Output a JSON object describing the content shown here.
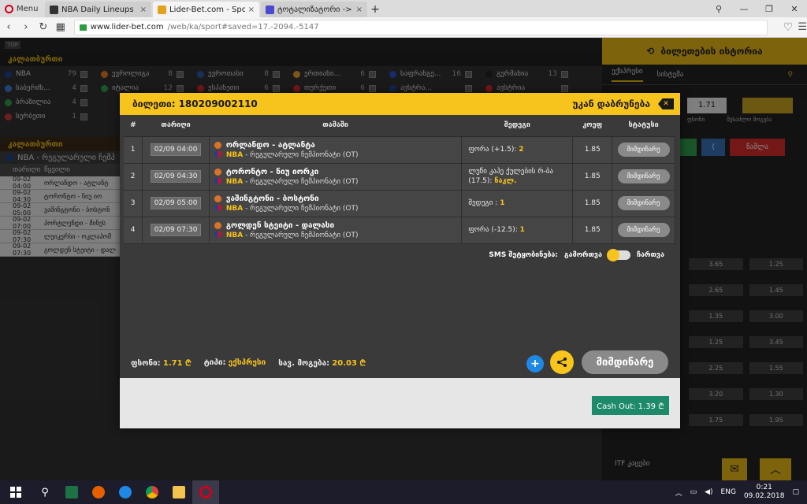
{
  "browser": {
    "menu_label": "Menu",
    "tabs": [
      {
        "title": "NBA Daily Lineups | RotoW",
        "close": "×",
        "favicon_color": "#333333"
      },
      {
        "title": "Lider-Bet.com - Sports an",
        "close": "×",
        "favicon_color": "#e4a11b"
      },
      {
        "title": "ტოტალიზატორი -> oი",
        "close": "×",
        "favicon_color": "#4a4ad0"
      }
    ],
    "new_tab": "+",
    "url_host": "www.lider-bet.com",
    "url_path": "/web/ka/sport#saved=17.-2094.-5147"
  },
  "background": {
    "top_label": "TOP",
    "section_title": "კალათბურთი",
    "leagues": [
      {
        "name": "NBA",
        "count": "79",
        "color": "#1d428a"
      },
      {
        "name": "ევროლიგა",
        "count": "8",
        "color": "#e07a1f"
      },
      {
        "name": "ევროთასი",
        "count": "8",
        "color": "#2c5aa0"
      },
      {
        "name": "ერთიანი...",
        "count": "6",
        "color": "#e0a030"
      },
      {
        "name": "საფრანგე...",
        "count": "16",
        "color": "#2b4ec2"
      },
      {
        "name": "გერმანია",
        "count": "13",
        "color": "#222222"
      },
      {
        "name": "საბერძნ...",
        "count": "4",
        "color": "#3a7bd5"
      },
      {
        "name": "იტალია",
        "count": "12",
        "color": "#2e9b4a"
      },
      {
        "name": "ესპანეთი",
        "count": "6",
        "color": "#d12a2a"
      },
      {
        "name": "თურქეთი",
        "count": "6",
        "color": "#d12a2a"
      },
      {
        "name": "ავსტრა...",
        "count": "",
        "color": "#1d428a"
      },
      {
        "name": "ავსტრია",
        "count": "",
        "color": "#d12a2a"
      },
      {
        "name": "ბრაზილია",
        "count": "4",
        "color": "#2e9b4a"
      },
      {
        "name": "",
        "count": "",
        "color": "#2b2b2b"
      },
      {
        "name": "",
        "count": "",
        "color": "#2b2b2b"
      },
      {
        "name": "",
        "count": "",
        "color": "#2b2b2b"
      },
      {
        "name": "",
        "count": "",
        "color": "#2b2b2b"
      },
      {
        "name": "",
        "count": "",
        "color": "#2b2b2b"
      },
      {
        "name": "სერბეთი",
        "count": "1",
        "color": "#c6363c"
      }
    ],
    "section2_title": "კალათბურთი",
    "nba_regular": "NBA - რეგულარული ჩემპ",
    "table_header": {
      "date": "თარიღი",
      "pair": "წყვილი"
    },
    "rows": [
      {
        "date": "09-02 04:00",
        "pair": "ორლანდო - ატლანტ"
      },
      {
        "date": "09-02 04:30",
        "pair": "ტორონტო - ნიუ იო"
      },
      {
        "date": "09-02 05:00",
        "pair": "ვაშინგტონი - ბოსტონ"
      },
      {
        "date": "09-02 07:00",
        "pair": "პორტლენდი - მინეს"
      },
      {
        "date": "09-02 07:30",
        "pair": "ლეიკერსი - ოკლაპომ"
      },
      {
        "date": "09-02 07:30",
        "pair": "გოლდენ სტეიტი - დალ"
      }
    ]
  },
  "right_panel": {
    "history_title": "ბილეთების ისტორია",
    "tabs": [
      "ექსპრესი",
      "სისტემა"
    ],
    "odds_value": "1.71",
    "label_odds": "ფსონი",
    "label_win": "შესაძლო მოგება",
    "remove_label": "წაშლა",
    "odds_rows": [
      {
        "a": "3.65",
        "b": "1.25"
      },
      {
        "a": "2.65",
        "b": "1.45"
      },
      {
        "a": "1.35",
        "b": "3.00"
      },
      {
        "a": "1.25",
        "b": "3.45"
      },
      {
        "a": "2.25",
        "b": "1.55"
      },
      {
        "a": "3.20",
        "b": "1.30"
      },
      {
        "a": "1.75",
        "b": "1.95"
      }
    ],
    "itf_label": "ITF კაცები"
  },
  "modal": {
    "ticket_label": "ბილეთი:",
    "ticket_id": "180209002110",
    "back_label": "უკან დაბრუნება",
    "close_icon": "✕",
    "columns": {
      "num": "#",
      "date": "თარიღი",
      "match": "თამაში",
      "pick": "შედეგი",
      "odd": "კოეფ",
      "status": "სტატუსი"
    },
    "bets": [
      {
        "num": "1",
        "date": "02/09 04:00",
        "teams": "ორლანდო - ატლანტა",
        "league": "NBA",
        "league_rest": "- რეგულარული ჩემპიონატი (OT)",
        "pick": "ფორა (+1.5):",
        "pick_value": "2",
        "odd": "1.85",
        "status": "მიმდინარე"
      },
      {
        "num": "2",
        "date": "02/09 04:30",
        "teams": "ტორონტო - ნიუ იორკი",
        "league": "NBA",
        "league_rest": "- რეგულარული ჩემპიონატი (OT)",
        "pick": "ლუწი კაპე ქულების რ-ბა (17.5):",
        "pick_value": "ნაკლ.",
        "odd": "1.85",
        "status": "მიმდინარე"
      },
      {
        "num": "3",
        "date": "02/09 05:00",
        "teams": "ვაშინგტონი - ბოსტონი",
        "league": "NBA",
        "league_rest": "- რეგულარული ჩემპიონატი (OT)",
        "pick": "შედეგი :",
        "pick_value": "1",
        "odd": "1.85",
        "status": "მიმდინარე"
      },
      {
        "num": "4",
        "date": "02/09 07:30",
        "teams": "გოლდენ სტეიტი - დალასი",
        "league": "NBA",
        "league_rest": "- რეგულარული ჩემპიონატი (OT)",
        "pick": "ფორა (-12.5):",
        "pick_value": "1",
        "odd": "1.85",
        "status": "მიმდინარე"
      }
    ],
    "sms_label": "SMS შეტყობინება:",
    "sms_on": "გამორთვა",
    "sms_off": "ჩართვა",
    "footer": {
      "stake_label": "ფსონი:",
      "stake_value": "1.71 ₾",
      "type_label": "ტიპი:",
      "type_value": "ექსპრესი",
      "win_label": "სავ. მოგება:",
      "win_value": "20.03 ₾"
    },
    "plus": "+",
    "current_button": "მიმდინარე",
    "cashout": "Cash Out: 1.39 ₾"
  },
  "taskbar": {
    "lang": "ENG",
    "time": "0:21",
    "date": "09.02.2018"
  }
}
